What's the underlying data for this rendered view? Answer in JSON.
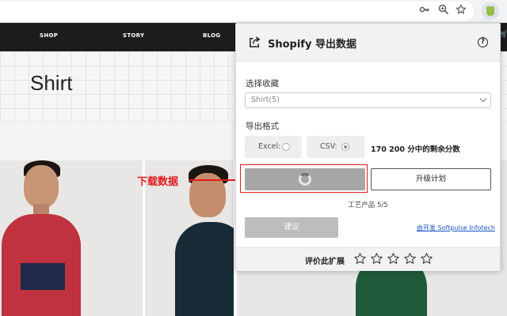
{
  "browser": {
    "icons": [
      "key-icon",
      "zoom-icon",
      "star-icon",
      "extension-icon"
    ]
  },
  "store": {
    "nav": [
      "SHOP",
      "STORY",
      "BLOG"
    ],
    "page_title": "Shirt"
  },
  "annotation": {
    "label": "下载数据"
  },
  "popup": {
    "title": "Shopify 导出数据",
    "collection_label": "选择收藏",
    "collection_value": "Shirt(5)",
    "format_label": "导出格式",
    "format_excel": "Excel:",
    "format_csv": "CSV:",
    "selected_format": "CSV",
    "credits": "170 200 分中的剩余分数",
    "upgrade_label": "升级计划",
    "product_count": "工艺产品 5/5",
    "suggest_label": "建议",
    "dev_link": "由开发 Softpulse Infotech",
    "rate_label": "评价此扩展",
    "stars_filled": 0,
    "stars_total": 5
  },
  "colors": {
    "accent_red": "#e01b1b",
    "nav_bg": "#1c1c1c",
    "download_btn": "#a6a6a6",
    "link": "#1a55c9"
  }
}
